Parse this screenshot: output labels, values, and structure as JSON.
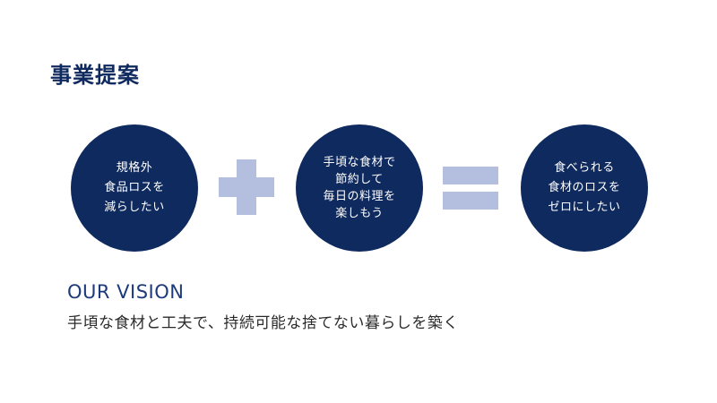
{
  "title": "事業提案",
  "circles": [
    {
      "lines": [
        "規格外",
        "食品ロスを",
        "減らしたい"
      ]
    },
    {
      "lines": [
        "手頃な食材で",
        "節約して",
        "毎日の料理を",
        "楽しもう"
      ]
    },
    {
      "lines": [
        "食べられる",
        "食材のロスを",
        "ゼロにしたい"
      ]
    }
  ],
  "operators": [
    "plus",
    "equals"
  ],
  "vision": {
    "heading": "OUR VISION",
    "text": "手頃な食材と工夫で、持続可能な捨てない暮らしを築く"
  },
  "colors": {
    "navy": "#0f2a5e",
    "operator": "#b4bfe0",
    "vision_heading": "#1d3a7a",
    "body_text": "#2b2b2b"
  }
}
